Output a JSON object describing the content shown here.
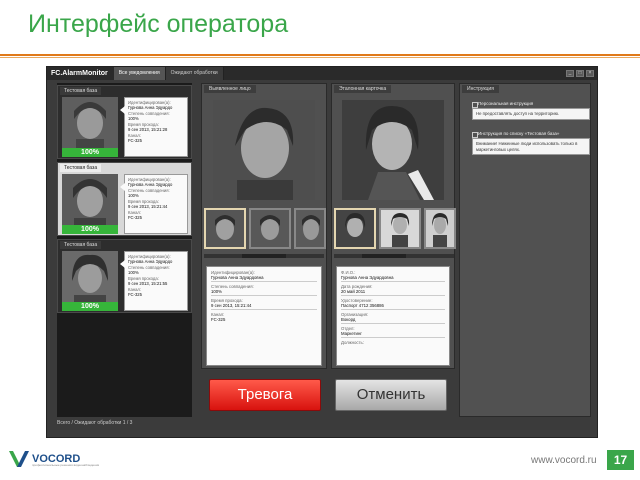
{
  "slide": {
    "title": "Интерфейс оператора",
    "website": "www.vocord.ru",
    "page_number": "17",
    "logo_text": "VOCORD",
    "logo_subtext": "профессиональные решения видеонаблюдения"
  },
  "app": {
    "name": "FC.AlarmMonitor",
    "tabs": [
      {
        "label": "Все уведомления",
        "active": true
      },
      {
        "label": "Ожидают обработки",
        "active": false
      }
    ],
    "window_controls": [
      "_",
      "□",
      "×"
    ],
    "status_bar": "Всего / Ожидают обработки   1 / 3"
  },
  "left_cards": [
    {
      "label": "Тестовая база",
      "percent": "100%",
      "fields": [
        {
          "label": "Идентифицирован(а):",
          "value": "Гурнова Анна Эдуардо"
        },
        {
          "label": "Степень совпадения:",
          "value": "100%"
        },
        {
          "label": "Время прохода:",
          "value": "9 сен 2013, 15:21:28"
        },
        {
          "label": "Канал:",
          "value": "FC-325"
        }
      ]
    },
    {
      "label": "Тестовая база",
      "percent": "100%",
      "fields": [
        {
          "label": "Идентифицирован(а):",
          "value": "Гурнова Анна Эдуардо"
        },
        {
          "label": "Степень совпадения:",
          "value": "100%"
        },
        {
          "label": "Время прохода:",
          "value": "9 сен 2013, 15:21:44"
        },
        {
          "label": "Канал:",
          "value": "FC-325"
        }
      ]
    },
    {
      "label": "Тестовая база",
      "percent": "100%",
      "fields": [
        {
          "label": "Идентифицирован(а):",
          "value": "Гурнова Анна Эдуардо"
        },
        {
          "label": "Степень совпадения:",
          "value": "100%"
        },
        {
          "label": "Время прохода:",
          "value": "9 сен 2013, 15:21:55"
        },
        {
          "label": "Канал:",
          "value": "FC-325"
        }
      ]
    }
  ],
  "detected_panel": {
    "tab": "Выявленное лицо",
    "fields": [
      {
        "label": "Идентифицирован(а):",
        "value": "Гурнова Анна Эдуардовна"
      },
      {
        "label": "Степень совпадения:",
        "value": "100%"
      },
      {
        "label": "Время прохода:",
        "value": "9 сен 2013, 15:21:44"
      },
      {
        "label": "Канал:",
        "value": "FC-325"
      }
    ]
  },
  "reference_panel": {
    "tab": "Эталонная карточка",
    "fields": [
      {
        "label": "Ф.И.О.:",
        "value": "Гурнова Анна Эдуардовна"
      },
      {
        "label": "Дата рождения:",
        "value": "20 май 2011"
      },
      {
        "label": "Удостоверение:",
        "value": "Паспорт 4712 356886"
      },
      {
        "label": "Организация:",
        "value": "Вокорд"
      },
      {
        "label": "Отдел:",
        "value": "Маркетинг"
      },
      {
        "label": "Должность:",
        "value": ""
      }
    ]
  },
  "buttons": {
    "alarm": "Тревога",
    "cancel": "Отменить"
  },
  "instructions": {
    "tab": "Инструкция",
    "items": [
      {
        "title": "Персональная инструкция",
        "body": "Не предоставлять доступ на территорию."
      },
      {
        "title": "Инструкция по списку «Тестовая база»",
        "body": "Внимание! Нижеиные люди использовать только в маркетинговых целях."
      }
    ]
  }
}
